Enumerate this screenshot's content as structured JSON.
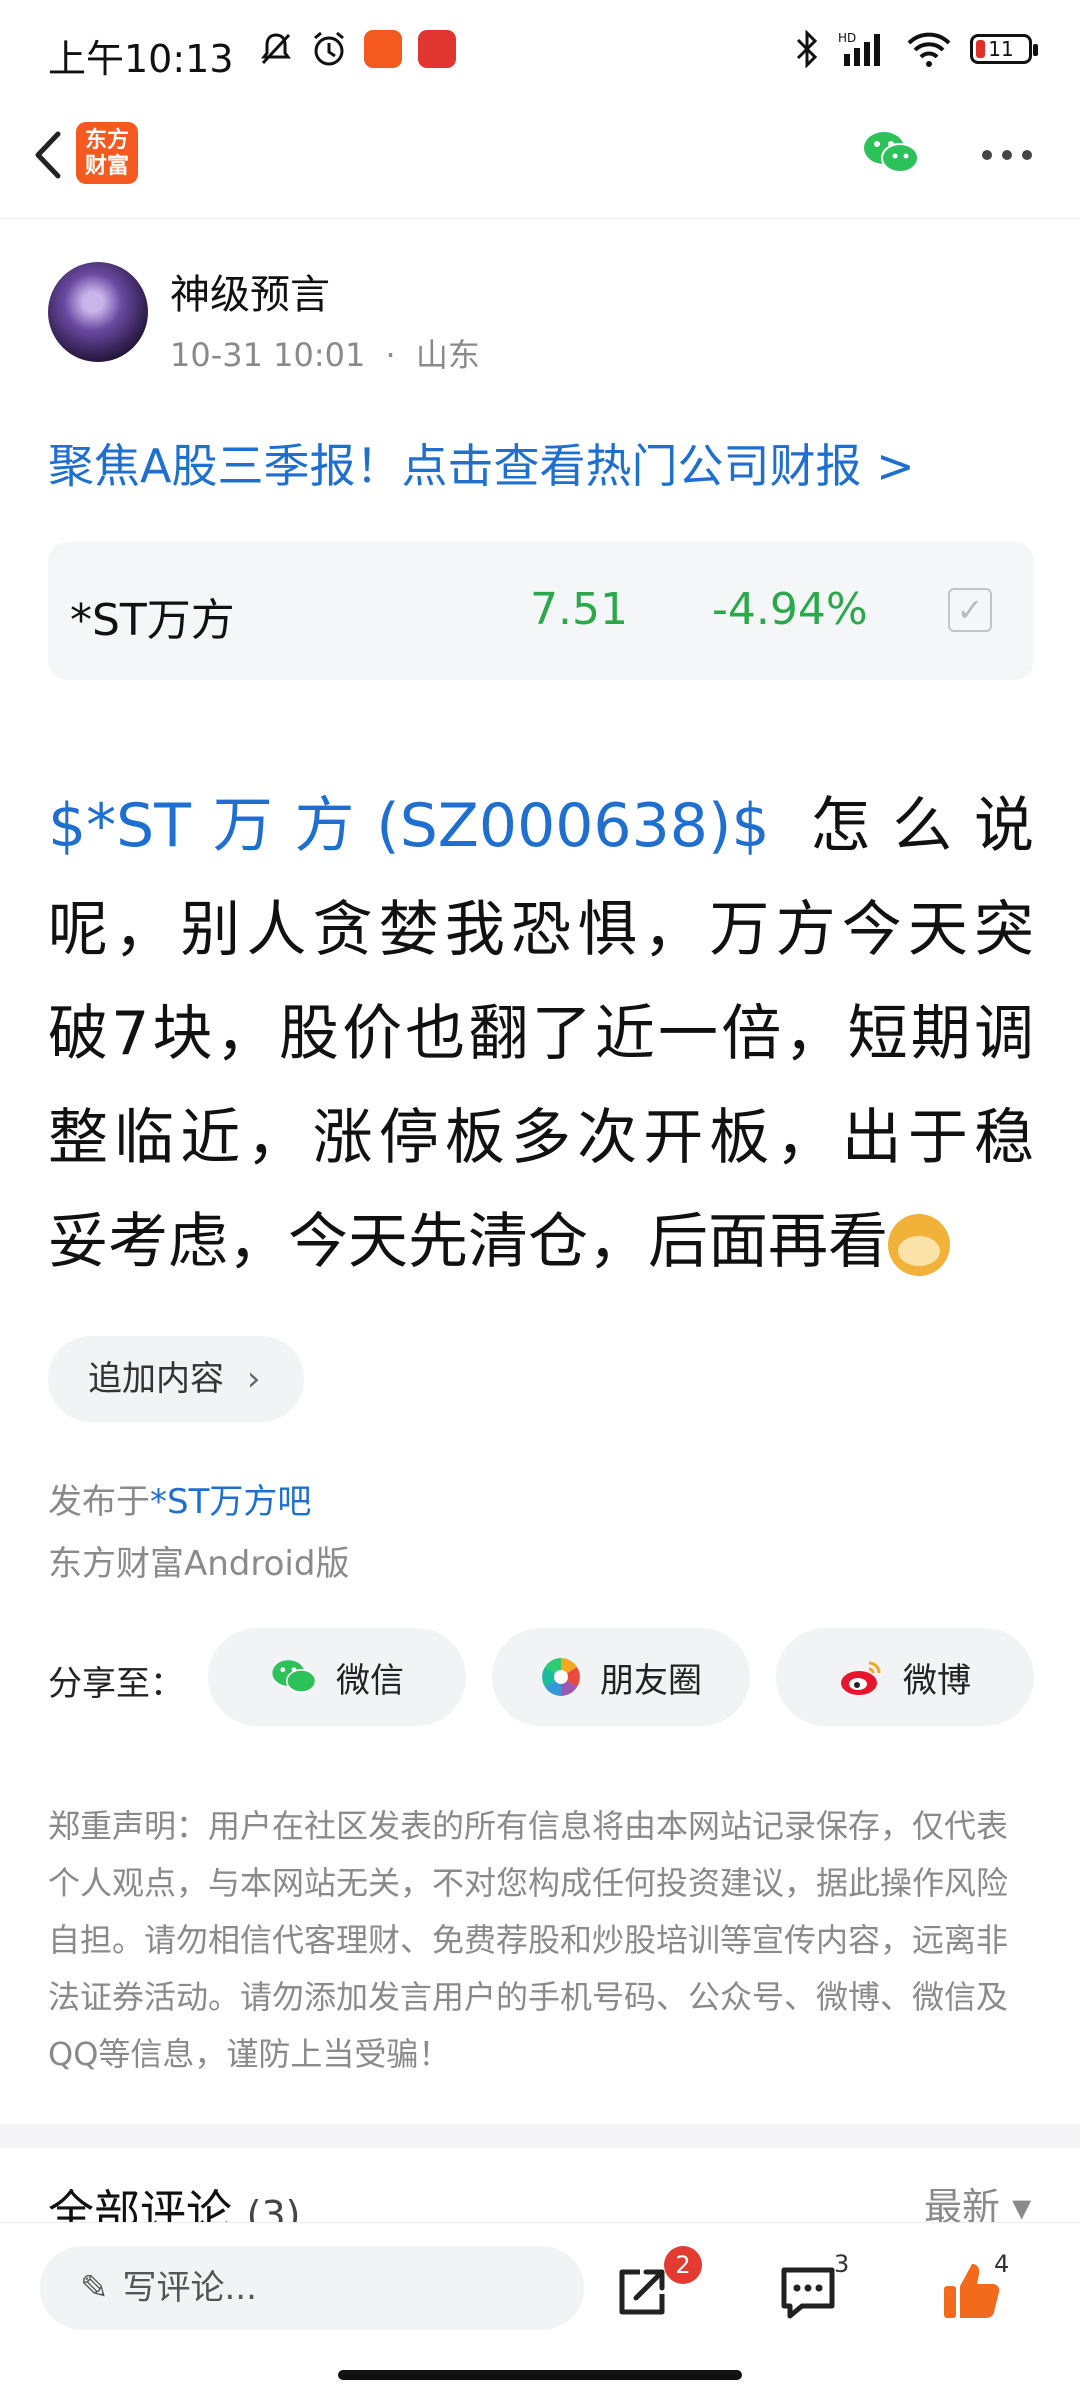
{
  "status_bar": {
    "time": "上午10:13",
    "battery": "11"
  },
  "header": {
    "logo_text": "东方财富"
  },
  "post": {
    "author": "神级预言",
    "date": "10-31 10:01",
    "separator": "·",
    "location": "山东",
    "promo_banner": "聚焦A股三季报！点击查看热门公司财报 >",
    "stock": {
      "name": "*ST万方",
      "price": "7.51",
      "change": "-4.94%"
    },
    "stock_tag": "$*ST万方(SZ000638)$",
    "body_lines": [
      "怎么说",
      "呢，别人贪婪我恐惧，万方今天突",
      "破7块，股价也翻了近一倍，短期调",
      "整临近，涨停板多次开板，出于稳",
      "妥考虑，今天先清仓，后面再看"
    ],
    "add_content_label": "追加内容",
    "published_prefix": "发布于",
    "published_bar": "*ST万方吧",
    "client": "东方财富Android版"
  },
  "share": {
    "label": "分享至：",
    "wechat": "微信",
    "moments": "朋友圈",
    "weibo": "微博"
  },
  "disclaimer": "郑重声明：用户在社区发表的所有信息将由本网站记录保存，仅代表个人观点，与本网站无关，不对您构成任何投资建议，据此操作风险自担。请勿相信代客理财、免费荐股和炒股培训等宣传内容，远离非法证券活动。请勿添加发言用户的手机号码、公众号、微博、微信及QQ等信息，谨防上当受骗！",
  "comments": {
    "title": "全部评论",
    "count": "(3)",
    "sort_label": "最新 ▾"
  },
  "bottom_bar": {
    "comment_placeholder": "写评论...",
    "share_badge": "2",
    "comment_count": "3",
    "like_count": "4"
  },
  "colors": {
    "link_blue": "#1f6fd1",
    "stock_green": "#2aa84a",
    "brand_orange": "#f45a1f",
    "like_orange": "#f26a1b",
    "badge_red": "#e33a32"
  }
}
